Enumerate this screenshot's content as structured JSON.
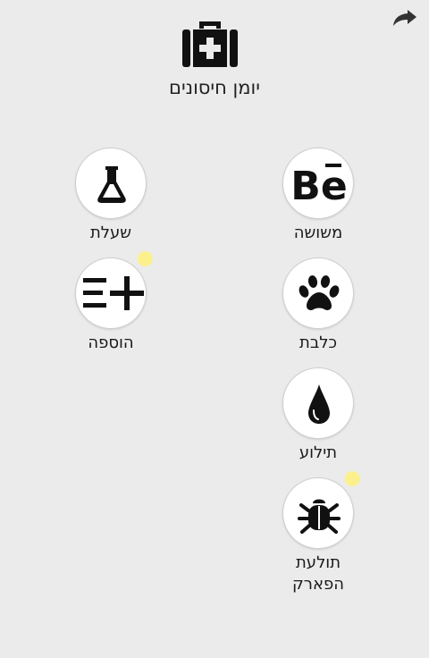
{
  "header": {
    "title": "יומן חיסונים",
    "icon": "first-aid-kit-icon",
    "share_icon": "share-arrow-icon"
  },
  "colors": {
    "background": "#ebebeb",
    "circle": "#ffffff",
    "notification_dot": "#fbf08c",
    "icon": "#111111"
  },
  "items": [
    {
      "label": "משושה",
      "icon": "behance-icon",
      "notification": false
    },
    {
      "label": "שעלת",
      "icon": "flask-icon",
      "notification": false
    },
    {
      "label": "כלבת",
      "icon": "paw-icon",
      "notification": false
    },
    {
      "label": "הוספה",
      "icon": "add-list-icon",
      "notification": true
    },
    {
      "label": "תילוע",
      "icon": "drop-icon",
      "notification": false
    },
    {
      "label": "תולעת\nהפארק",
      "icon": "bug-icon",
      "notification": true
    }
  ]
}
